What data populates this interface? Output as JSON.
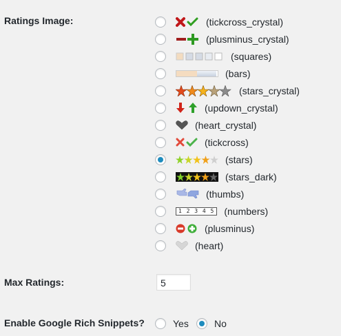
{
  "ratings_image": {
    "label": "Ratings Image:",
    "selected": "(stars)",
    "options": [
      {
        "label": "(tickcross_crystal)",
        "icon": "tickcross-crystal-icon"
      },
      {
        "label": "(plusminus_crystal)",
        "icon": "plusminus-crystal-icon"
      },
      {
        "label": "(squares)",
        "icon": "squares-icon"
      },
      {
        "label": "(bars)",
        "icon": "bars-icon"
      },
      {
        "label": "(stars_crystal)",
        "icon": "stars-crystal-icon"
      },
      {
        "label": "(updown_crystal)",
        "icon": "updown-crystal-icon"
      },
      {
        "label": "(heart_crystal)",
        "icon": "heart-crystal-icon"
      },
      {
        "label": "(tickcross)",
        "icon": "tickcross-icon"
      },
      {
        "label": "(stars)",
        "icon": "stars-icon"
      },
      {
        "label": "(stars_dark)",
        "icon": "stars-dark-icon"
      },
      {
        "label": "(thumbs)",
        "icon": "thumbs-icon"
      },
      {
        "label": "(numbers)",
        "icon": "numbers-icon"
      },
      {
        "label": "(plusminus)",
        "icon": "plusminus-icon"
      },
      {
        "label": "(heart)",
        "icon": "heart-icon"
      }
    ],
    "numbers_icon_digits": "1 2 3 4 5"
  },
  "max_ratings": {
    "label": "Max Ratings:",
    "value": "5"
  },
  "rich_snippets": {
    "label": "Enable Google Rich Snippets?",
    "yes": "Yes",
    "no": "No",
    "selected": "No"
  },
  "colors": {
    "radio_checked": "#1e8cbe",
    "background": "#f1f1f1"
  }
}
